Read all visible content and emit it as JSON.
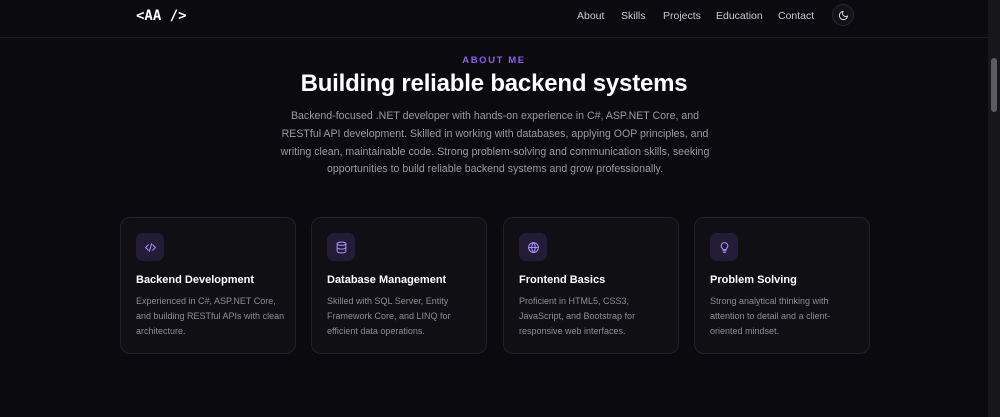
{
  "header": {
    "logo": "<AA />",
    "nav": [
      {
        "label": "About"
      },
      {
        "label": "Skills"
      },
      {
        "label": "Projects"
      },
      {
        "label": "Education"
      },
      {
        "label": "Contact"
      }
    ],
    "theme_toggle_icon": "moon-icon"
  },
  "about": {
    "eyebrow": "ABOUT ME",
    "title": "Building reliable backend systems",
    "description": "Backend-focused .NET developer with hands-on experience in C#, ASP.NET Core, and RESTful API development. Skilled in working with databases, applying OOP principles, and writing clean, maintainable code. Strong problem-solving and communication skills, seeking opportunities to build reliable backend systems and grow professionally."
  },
  "cards": [
    {
      "icon": "code-icon",
      "title": "Backend Development",
      "text": "Experienced in C#, ASP.NET Core, and building RESTful APIs with clean architecture."
    },
    {
      "icon": "database-icon",
      "title": "Database Management",
      "text": "Skilled with SQL Server, Entity Framework Core, and LINQ for efficient data operations."
    },
    {
      "icon": "globe-icon",
      "title": "Frontend Basics",
      "text": "Proficient in HTML5, CSS3, JavaScript, and Bootstrap for responsive web interfaces."
    },
    {
      "icon": "lightbulb-icon",
      "title": "Problem Solving",
      "text": "Strong analytical thinking with attention to detail and a client-oriented mindset."
    }
  ],
  "colors": {
    "accent": "#8b5cf6",
    "background": "#0b0a0e",
    "card_background": "#100f14",
    "text_muted": "#9c99a3"
  }
}
